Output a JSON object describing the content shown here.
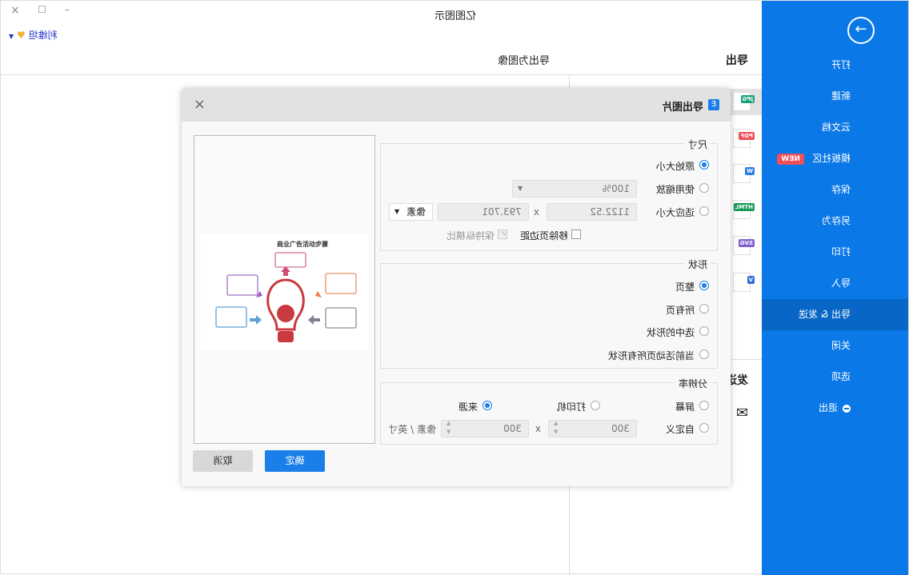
{
  "window": {
    "title": "亿图图示",
    "user": "利维坦",
    "close": "×",
    "maximize": "☐",
    "minimize": "–"
  },
  "sidebar": {
    "items": [
      {
        "label": "打开"
      },
      {
        "label": "新建"
      },
      {
        "label": "云文档"
      },
      {
        "label": "模板社区",
        "badge": "NEW"
      },
      {
        "label": "保存"
      },
      {
        "label": "另存为"
      },
      {
        "label": "打印"
      },
      {
        "label": "导入"
      },
      {
        "label": "导出 & 发送",
        "selected": true
      },
      {
        "label": "关闭"
      },
      {
        "label": "选项"
      },
      {
        "label": "退出"
      }
    ]
  },
  "header": {
    "section": "导出",
    "subtitle": "导出为图像"
  },
  "filetypes": [
    {
      "label": "JPG",
      "color": "#1aa37a"
    },
    {
      "label": "PDF",
      "color": "#f0505a"
    },
    {
      "label": "W",
      "color": "#2f7fe0"
    },
    {
      "label": "HTML",
      "color": "#1a9a5a"
    },
    {
      "label": "SVG",
      "color": "#8060d0"
    },
    {
      "label": "V",
      "color": "#2f6fd0"
    }
  ],
  "send": {
    "title": "发送"
  },
  "dialog": {
    "title": "导出图片",
    "close": "×",
    "size": {
      "legend": "尺寸",
      "original": "原始大小",
      "zoom": "使用缩放",
      "zoom_value": "100%",
      "fit": "适应大小",
      "width": "1122.52",
      "x": "x",
      "height": "793.701",
      "unit": "像素",
      "remove_margin": "移除页边距",
      "keep_ratio": "保持纵横比",
      "selected": "原始大小"
    },
    "shape": {
      "legend": "形状",
      "options": [
        "整页",
        "所有页",
        "选中的形状",
        "当前活动页所有形状"
      ],
      "selected": "整页"
    },
    "resolution": {
      "legend": "分辨率",
      "screen": "屏幕",
      "printer": "打印机",
      "source": "来源",
      "custom": "自定义",
      "w": "300",
      "x": "x",
      "h": "300",
      "unit": "像素 / 英寸",
      "selected": "来源"
    },
    "preview": {
      "title": "商业广告活动步骤"
    },
    "ok": "确定",
    "cancel": "取消"
  },
  "colors": {
    "accent": "#0b78e8",
    "selected": "#0866c6"
  }
}
